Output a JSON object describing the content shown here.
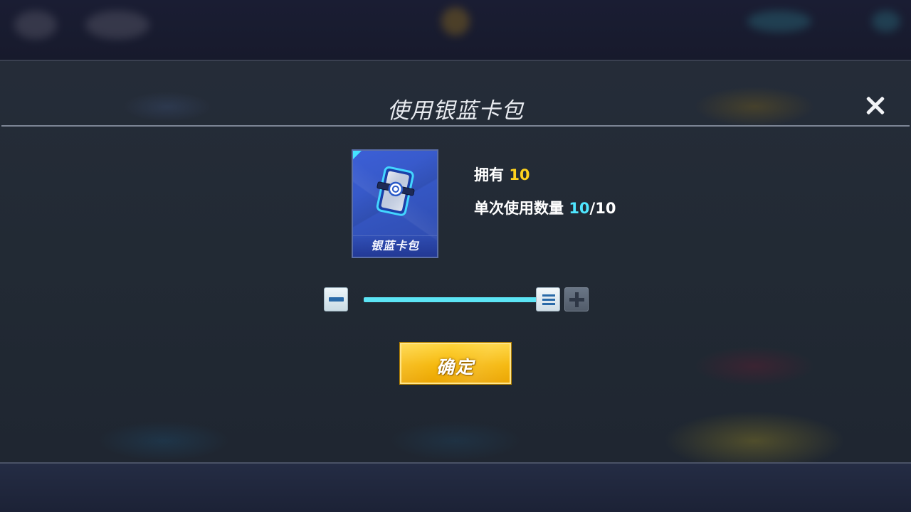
{
  "dialog": {
    "title": "使用银蓝卡包",
    "close_icon": "close-icon"
  },
  "item": {
    "name": "银蓝卡包",
    "icon": "card-pack-icon",
    "owned_label": "拥有",
    "owned_count": "10",
    "use_label": "单次使用数量",
    "use_count": "10",
    "use_max": "/10"
  },
  "slider": {
    "value": 10,
    "min": 0,
    "max": 10,
    "minus_icon": "minus-icon",
    "plus_icon": "plus-icon",
    "handle_icon": "slider-handle-icon"
  },
  "confirm": {
    "label": "确定"
  },
  "colors": {
    "owned_count": "#ffd21e",
    "use_count": "#4fe6ff",
    "slider_fill": "#5ce4f5",
    "confirm_button": "#f5b70b"
  }
}
